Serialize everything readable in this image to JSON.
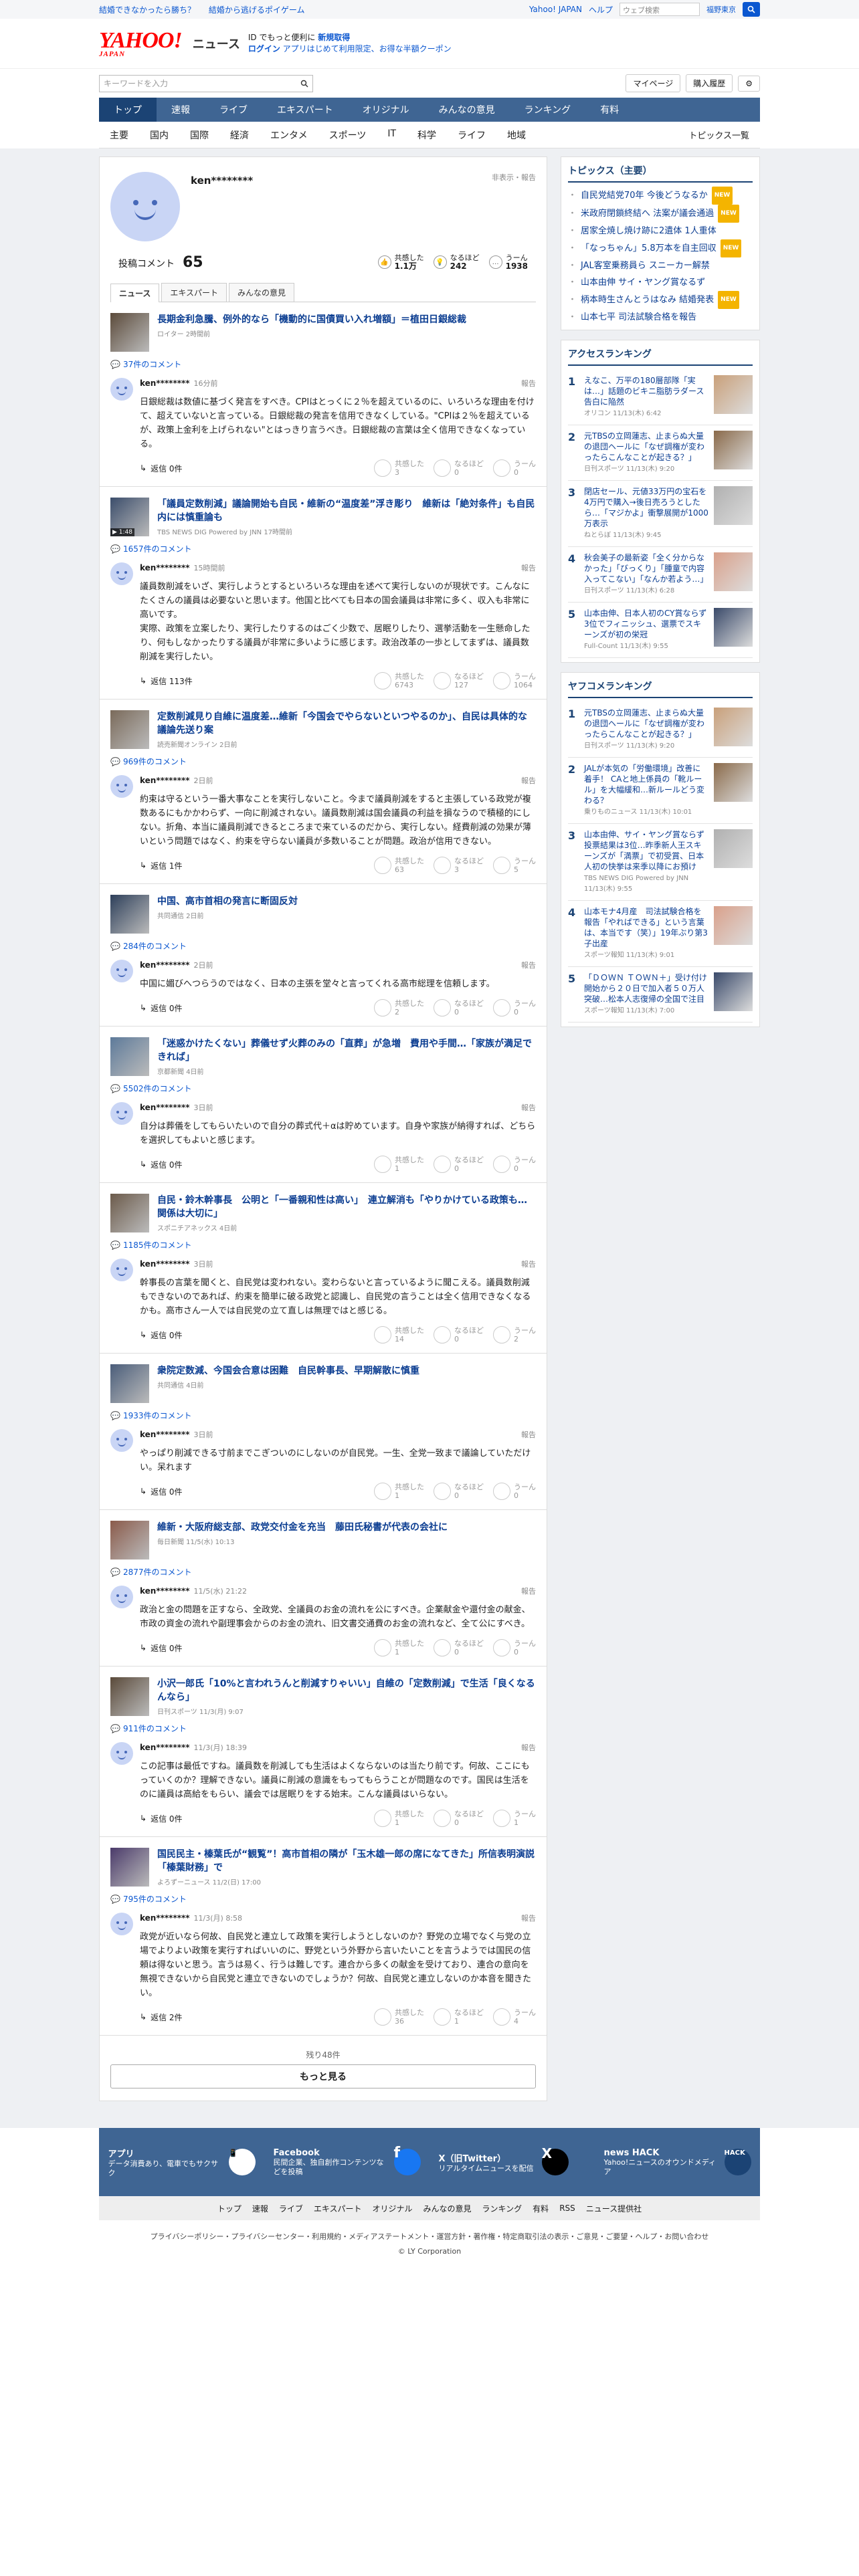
{
  "topbar": {
    "left": [
      "結婚できなかったら勝ち？",
      "結婚から逃げるポイゲーム"
    ],
    "links": [
      "Yahoo! JAPAN",
      "ヘルプ"
    ],
    "search_placeholder": "ウェブ検索",
    "area": "福野東京"
  },
  "header": {
    "logo": "YAHOO!",
    "logo_sub": "JAPAN",
    "service": "ニュース",
    "promo_line1_a": "ID でもっと便利に",
    "promo_line1_b": "新規取得",
    "promo_line2_a": "ログイン",
    "promo_line2_b": "アプリはじめて利用限定、お得な半額クーポン"
  },
  "searchrow": {
    "placeholder": "キーワードを入力",
    "mypage": "マイページ",
    "history": "購入履歴"
  },
  "gnav": [
    "トップ",
    "速報",
    "ライブ",
    "エキスパート",
    "オリジナル",
    "みんなの意見",
    "ランキング",
    "有料"
  ],
  "subnav": [
    "主要",
    "国内",
    "国際",
    "経済",
    "エンタメ",
    "スポーツ",
    "IT",
    "科学",
    "ライフ",
    "地域"
  ],
  "subnav_right": "トピックス一覧",
  "profile": {
    "name": "ken********",
    "hidden_label": "非表示・報告",
    "count_label": "投稿コメント",
    "count": "65",
    "reactions": [
      {
        "label": "共感した",
        "value": "1.1万"
      },
      {
        "label": "なるほど",
        "value": "242"
      },
      {
        "label": "うーん",
        "value": "1938"
      }
    ]
  },
  "tabs": [
    "ニュース",
    "エキスパート",
    "みんなの意見"
  ],
  "comments": [
    {
      "title": "長期金利急騰、例外的なら「機動的に国債買い入れ増額」＝植田日銀総裁",
      "src": "ロイター 2時間前",
      "count": "37件のコメント",
      "user": "ken********",
      "time": "16分前",
      "text": "日銀総裁は数値に基づく発言をすべき。CPIはとっくに２％を超えているのに、いろいろな理由を付けて、超えていないと言っている。日銀総裁の発言を信用できなくしている。\"CPIは２％を超えているが、政策上金利を上げられない\"とはっきり言うべき。日銀総裁の言葉は全く信用できなくなっている。",
      "reply": "返信 0件",
      "v": [
        "3",
        "0",
        "0"
      ]
    },
    {
      "title": "「議員定数削減」議論開始も自民・維新の“温度差”浮き彫り　維新は「絶対条件」も自民内には慎重論も",
      "src": "TBS NEWS DIG Powered by JNN 17時間前",
      "count": "1657件のコメント",
      "user": "ken********",
      "time": "15時間前",
      "text": "議員数削減をいざ、実行しようとするといろいろな理由を述べて実行しないのが現状です。こんなにたくさんの議員は必要ないと思います。他国と比べても日本の国会議員は非常に多く、収入も非常に高いです。\n実際、政策を立案したり、実行したりするのはごく少数で、居眠りしたり、選挙活動を一生懸命したり、何もしなかったりする議員が非常に多いように感じます。政治改革の一歩としてまずは、議員数削減を実行したい。",
      "reply": "返信 113件",
      "v": [
        "6743",
        "127",
        "1064"
      ]
    },
    {
      "title": "定数削減見り自維に温度差…維新「今国会でやらないといつやるのか」、自民は具体的な議論先送り案",
      "src": "読売新聞オンライン 2日前",
      "count": "969件のコメント",
      "user": "ken********",
      "time": "2日前",
      "text": "約束は守るという一番大事なことを実行しないこと。今まで議員削減をすると主張している政党が複数あるにもかかわらず、一向に削減されない。議員数削減は国会議員の利益を損なうので積極的にしない。折角、本当に議員削減できるところまで来ているのだから、実行しない。経費削減の効果が薄いという問題ではなく、約束を守らない議員が多数いることが問題。政治が信用できない。",
      "reply": "返信 1件",
      "v": [
        "63",
        "3",
        "5"
      ]
    },
    {
      "title": "中国、高市首相の発言に断固反対",
      "src": "共同通信 2日前",
      "count": "284件のコメント",
      "user": "ken********",
      "time": "2日前",
      "text": "中国に媚びへつらうのではなく、日本の主張を堂々と言ってくれる高市総理を信頼します。",
      "reply": "返信 0件",
      "v": [
        "2",
        "0",
        "0"
      ]
    },
    {
      "title": "「迷惑かけたくない」葬儀せず火葬のみの「直葬」が急増　費用や手間…「家族が満足できれば」",
      "src": "京都新聞 4日前",
      "count": "5502件のコメント",
      "user": "ken********",
      "time": "3日前",
      "text": "自分は葬儀をしてもらいたいので自分の葬式代＋αは貯めています。自身や家族が納得すれば、どちらを選択してもよいと感じます。",
      "reply": "返信 0件",
      "v": [
        "1",
        "0",
        "0"
      ]
    },
    {
      "title": "自民・鈴木幹事長　公明と「一番親和性は高い」　連立解消も「やりかけている政策も…関係は大切に」",
      "src": "スポニチアネックス 4日前",
      "count": "1185件のコメント",
      "user": "ken********",
      "time": "3日前",
      "text": "幹事長の言葉を聞くと、自民党は変われない。変わらないと言っているように聞こえる。議員数削減もできないのであれば、約束を簡単に破る政党と認識し、自民党の言うことは全く信用できなくなるかも。高市さん一人では自民党の立て直しは無理ではと感じる。",
      "reply": "返信 0件",
      "v": [
        "14",
        "0",
        "2"
      ]
    },
    {
      "title": "衆院定数減、今国会合意は困難　自民幹事長、早期解散に慎重",
      "src": "共同通信 4日前",
      "count": "1933件のコメント",
      "user": "ken********",
      "time": "3日前",
      "text": "やっぱり削減できる寸前までこぎついのにしないのが自民党。一生、全党一致まで議論していただけい。呆れます",
      "reply": "返信 0件",
      "v": [
        "1",
        "0",
        "0"
      ]
    },
    {
      "title": "維新・大阪府総支部、政党交付金を充当　藤田氏秘書が代表の会社に",
      "src": "毎日新聞 11/5(水) 10:13",
      "count": "2877件のコメント",
      "user": "ken********",
      "time": "11/5(水) 21:22",
      "text": "政治と金の問題を正すなら、全政党、全議員のお金の流れを公にすべき。企業献金や還付金の献金、市政の資金の流れや副理事会からのお金の流れ、旧文書交通費のお金の流れなど、全て公にすべき。",
      "reply": "返信 0件",
      "v": [
        "1",
        "0",
        "0"
      ]
    },
    {
      "title": "小沢一郎氏「10%と言われうんと削減すりゃいい」自維の「定数削減」で生活「良くなるんなら」",
      "src": "日刊スポーツ 11/3(月) 9:07",
      "count": "911件のコメント",
      "user": "ken********",
      "time": "11/3(月) 18:39",
      "text": "この記事は最低ですね。議員数を削減しても生活はよくならないのは当たり前です。何故、ここにもっていくのか？理解できない。議員に削減の意識をもってもらうことが問題なのです。国民は生活をのに議員は高給をもらい、議会では居眠りをする始末。こんな議員はいらない。",
      "reply": "返信 0件",
      "v": [
        "1",
        "0",
        "1"
      ]
    },
    {
      "title": "国民民主・榛葉氏が“観覧”！高市首相の隣が「玉木雄一郎の席になてきた」所信表明演説「榛葉財務」で",
      "src": "よろずーニュース 11/2(日) 17:00",
      "count": "795件のコメント",
      "user": "ken********",
      "time": "11/3(月) 8:58",
      "text": "政党が近いなら何故、自民党と連立して政策を実行しようとしないのか？野党の立場でなく与党の立場でよりよい政策を実行すればいいのに、野党という外野から言いたいことを言うようでは国民の信頼は得ないと思う。言うは易く、行うは難しです。連合から多くの献金を受けており、連合の意向を無視できないから自民党と連立できないのでしょうか？何故、自民党と連立しないのか本音を聞きたい。",
      "reply": "返信 2件",
      "v": [
        "36",
        "1",
        "4"
      ]
    }
  ],
  "vote_labels": [
    "共感した",
    "なるほど",
    "うーん"
  ],
  "more": {
    "rest": "残り48件",
    "button": "もっと見る"
  },
  "report": "報告",
  "side": {
    "topics_title": "トピックス（主要）",
    "topics": [
      {
        "t": "自民党結党70年 今後どうなるか",
        "b": "NEW"
      },
      {
        "t": "米政府閉鎖終結へ 法案が議会通過",
        "b": "NEW"
      },
      {
        "t": "居家全焼し焼け跡に2遺体 1人重体",
        "b": ""
      },
      {
        "t": "「なっちゃん」5.8万本を自主回収",
        "b": "NEW"
      },
      {
        "t": "JAL客室乗務員ら スニーカー解禁",
        "b": ""
      },
      {
        "t": "山本由伸 サイ・ヤング賞なるず",
        "b": ""
      },
      {
        "t": "柄本時生さんとうはなみ 結婚発表",
        "b": "NEW"
      },
      {
        "t": "山本七平 司法試験合格を報告",
        "b": ""
      }
    ],
    "access_title": "アクセスランキング",
    "access": [
      {
        "t": "えなこ、万平の180層部隊「実は…」話題のビキニ脂肪ラダース告白に陥然",
        "s": "オリコン 11/13(木) 6:42"
      },
      {
        "t": "元TBSの立岡蓮志、止まらぬ大量の退団ヘールに「なぜ調権が変わったらこんなことが起きる？」",
        "s": "日刊スポーツ 11/13(木) 9:20"
      },
      {
        "t": "閉店セール、元値33万円の宝石を4万円で購入→後日売ろうとしたら…「マジかよ」衝撃展開が1000万表示",
        "s": "ねとらぼ 11/13(木) 9:45"
      },
      {
        "t": "秋会美子の最新姿「全く分からなかった」「びっくり」「腫童で内容入ってこない」「なんか若よう…」",
        "s": "日刊スポーツ 11/13(木) 6:28"
      },
      {
        "t": "山本由伸、日本人初のCY賞ならず 3位でフィニッシュ、選票でスキーンズが初の栄冠",
        "s": "Full-Count 11/13(木) 9:55"
      }
    ],
    "yahoo_title": "ヤフコメランキング",
    "yahoo": [
      {
        "t": "元TBSの立岡蓮志、止まらぬ大量の退団ヘールに「なぜ調権が変わったらこんなことが起きる？」",
        "s": "日刊スポーツ 11/13(木) 9:20"
      },
      {
        "t": "JALが本気の「労働環境」改善に着手！ CAと地上係員の「靴ルール」を大幅緩和…新ルールどう変わる？",
        "s": "乗りものニュース 11/13(木) 10:01"
      },
      {
        "t": "山本由伸、サイ・ヤング賞ならず 投票結果は3位…昨季新人王スキーンズが「満票」で初受賞、日本人初の快挙は来季以降にお預け",
        "s": "TBS NEWS DIG Powered by JNN 11/13(木) 9:55"
      },
      {
        "t": "山本モナ4月産　司法試験合格を報告「やればできる」という言葉は、本当です（笑）」19年ぶり第3子出産",
        "s": "スポーツ報知 11/13(木) 9:01"
      },
      {
        "t": "「ＤＯＷＮ ＴＯＷＮ＋」受け付け開始から２０日で加入者５０万人突破…松本人志復帰の全国で注目",
        "s": "スポーツ報知 11/13(木) 7:00"
      }
    ]
  },
  "footer": {
    "apps": [
      {
        "name": "アプリ",
        "desc": "データ消費あり、電車でもサクサク"
      },
      {
        "name": "Facebook",
        "desc": "民間企業、独自創作コンテンツなどを投稿"
      },
      {
        "name": "X（旧Twitter）",
        "desc": "リアルタイムニュースを配信"
      },
      {
        "name": "news HACK",
        "desc": "Yahoo!ニュースのオウンドメディア"
      }
    ],
    "nav": [
      "トップ",
      "速報",
      "ライブ",
      "エキスパート",
      "オリジナル",
      "みんなの意見",
      "ランキング",
      "有料",
      "RSS",
      "ニュース提供社"
    ],
    "legal": "プライバシーポリシー・プライバシーセンター・利用規約・メディアステートメント・運営方針・著作権・特定商取引法の表示・ご意見・ご要望・ヘルプ・お問い合わせ",
    "copy": "© LY Corporation"
  },
  "colors": {
    "accent": "#3f6593",
    "link": "#0b3d91"
  }
}
